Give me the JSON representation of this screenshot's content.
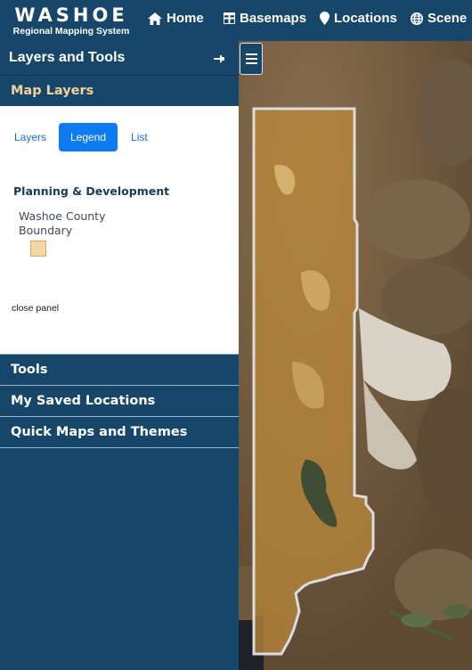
{
  "header": {
    "brand_title": "WASHOE",
    "brand_subtitle": "Regional Mapping System",
    "nav": [
      {
        "label": "Home",
        "icon": "home-icon"
      },
      {
        "label": "Basemaps",
        "icon": "grid-icon"
      },
      {
        "label": "Locations",
        "icon": "map-marker-icon"
      },
      {
        "label": "Scene",
        "icon": "globe-icon"
      }
    ]
  },
  "sidebar": {
    "title": "Layers and Tools",
    "pin_icon": "pin-icon",
    "map_layers": {
      "label": "Map Layers",
      "tabs": [
        {
          "label": "Layers",
          "active": false
        },
        {
          "label": "Legend",
          "active": true
        },
        {
          "label": "List",
          "active": false
        }
      ],
      "legend": {
        "group_heading": "Planning & Development",
        "item_label": "Washoe County Boundary",
        "swatch_color": "#f0d9a2"
      },
      "close_label": "close panel"
    },
    "sections": [
      {
        "label": "Tools"
      },
      {
        "label": "My Saved Locations"
      },
      {
        "label": "Quick Maps and Themes"
      }
    ]
  },
  "colors": {
    "header_bg": "#17466b",
    "accent_open": "#f2d29b",
    "active_tab": "#0d7bf2"
  }
}
